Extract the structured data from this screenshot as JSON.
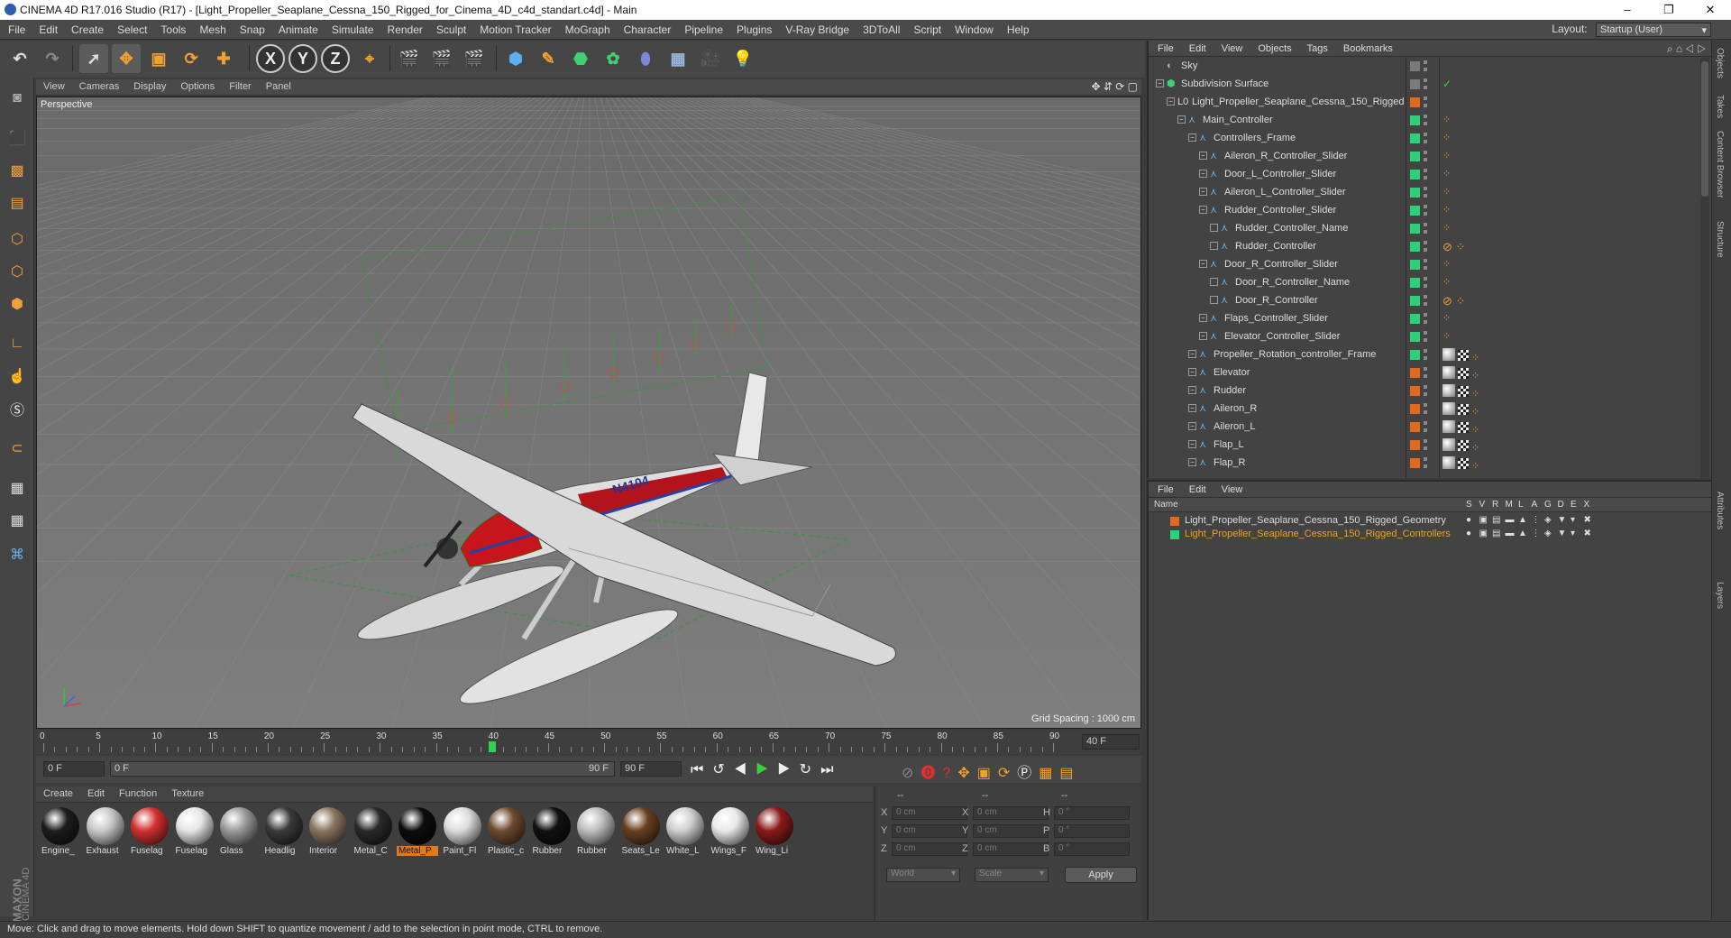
{
  "titlebar": {
    "title": "CINEMA 4D R17.016 Studio (R17) - [Light_Propeller_Seaplane_Cessna_150_Rigged_for_Cinema_4D_c4d_standart.c4d] - Main",
    "minimize": "–",
    "maximize": "❐",
    "close": "✕"
  },
  "menubar": {
    "items": [
      "File",
      "Edit",
      "Create",
      "Select",
      "Tools",
      "Mesh",
      "Snap",
      "Animate",
      "Simulate",
      "Render",
      "Sculpt",
      "Motion Tracker",
      "MoGraph",
      "Character",
      "Pipeline",
      "Plugins",
      "V-Ray Bridge",
      "3DToAll",
      "Script",
      "Window",
      "Help"
    ],
    "layout_label": "Layout:",
    "layout_value": "Startup (User)"
  },
  "toolbar": {
    "axis_x": "X",
    "axis_y": "Y",
    "axis_z": "Z"
  },
  "viewport": {
    "menu": [
      "View",
      "Cameras",
      "Display",
      "Options",
      "Filter",
      "Panel"
    ],
    "label": "Perspective",
    "grid_spacing": "Grid Spacing : 1000 cm",
    "tail_number": "N4104"
  },
  "timeline": {
    "ticks": [
      "0",
      "5",
      "10",
      "15",
      "20",
      "25",
      "30",
      "35",
      "40",
      "45",
      "50",
      "55",
      "60",
      "65",
      "70",
      "75",
      "80",
      "85",
      "90"
    ],
    "current_frame_field": "40 F",
    "playhead_frame": 40
  },
  "transport": {
    "start_field": "0 F",
    "range_start": "0 F",
    "range_end": "90 F",
    "end_field": "90 F"
  },
  "materials": {
    "menu": [
      "Create",
      "Edit",
      "Function",
      "Texture"
    ],
    "items": [
      {
        "label": "Engine_",
        "color": "#1d1d1d"
      },
      {
        "label": "Exhaust",
        "color": "#c8c8c8"
      },
      {
        "label": "Fuselag",
        "color": "#d23030"
      },
      {
        "label": "Fuselag",
        "color": "#e5e5e5"
      },
      {
        "label": "Glass",
        "color": "#9a9a9a"
      },
      {
        "label": "Headlig",
        "color": "#3a3a3a"
      },
      {
        "label": "Interior",
        "color": "#8a7460"
      },
      {
        "label": "Metal_C",
        "color": "#2a2a2a"
      },
      {
        "label": "Metal_P",
        "color": "#0d0d0d"
      },
      {
        "label": "Paint_Fl",
        "color": "#dcdcdc"
      },
      {
        "label": "Plastic_c",
        "color": "#6e4a30"
      },
      {
        "label": "Rubber",
        "color": "#111111"
      },
      {
        "label": "Rubber",
        "color": "#bdbdbd"
      },
      {
        "label": "Seats_Le",
        "color": "#6a4020"
      },
      {
        "label": "White_L",
        "color": "#cfcfcf"
      },
      {
        "label": "Wings_F",
        "color": "#e8e8e8"
      },
      {
        "label": "Wing_Li",
        "color": "#8a1a1a"
      }
    ],
    "selected_index": 8
  },
  "coords": {
    "headers": [
      "--",
      "--",
      "--"
    ],
    "rows": [
      {
        "a": "X",
        "av": "0 cm",
        "b": "X",
        "bv": "0 cm",
        "c": "H",
        "cv": "0 °"
      },
      {
        "a": "Y",
        "av": "0 cm",
        "b": "Y",
        "bv": "0 cm",
        "c": "P",
        "cv": "0 °"
      },
      {
        "a": "Z",
        "av": "0 cm",
        "b": "Z",
        "bv": "0 cm",
        "c": "B",
        "cv": "0 °"
      }
    ],
    "mode1": "World",
    "mode2": "Scale",
    "apply": "Apply"
  },
  "objects": {
    "menu": [
      "File",
      "Edit",
      "View",
      "Objects",
      "Tags",
      "Bookmarks"
    ],
    "rows": [
      {
        "name": "Sky",
        "depth": 0,
        "icon": "sky",
        "layer": "#7a7a7a",
        "tags": ""
      },
      {
        "name": "Subdivision Surface",
        "depth": 0,
        "icon": "subdiv",
        "layer": "#7a7a7a",
        "tags": "check"
      },
      {
        "name": "Light_Propeller_Seaplane_Cessna_150_Rigged",
        "depth": 1,
        "icon": "null",
        "layer": "#e06a20",
        "tags": ""
      },
      {
        "name": "Main_Controller",
        "depth": 2,
        "icon": "joint",
        "layer": "#2fd07a",
        "tags": "dot"
      },
      {
        "name": "Controllers_Frame",
        "depth": 3,
        "icon": "joint",
        "layer": "#2fd07a",
        "tags": "dot"
      },
      {
        "name": "Aileron_R_Controller_Slider",
        "depth": 4,
        "icon": "joint",
        "layer": "#2fd07a",
        "tags": "dot"
      },
      {
        "name": "Door_L_Controller_Slider",
        "depth": 4,
        "icon": "joint",
        "layer": "#2fd07a",
        "tags": "dot"
      },
      {
        "name": "Aileron_L_Controller_Slider",
        "depth": 4,
        "icon": "joint",
        "layer": "#2fd07a",
        "tags": "dot"
      },
      {
        "name": "Rudder_Controller_Slider",
        "depth": 4,
        "icon": "joint",
        "layer": "#2fd07a",
        "tags": "dot"
      },
      {
        "name": "Rudder_Controller_Name",
        "depth": 5,
        "icon": "joint",
        "layer": "#2fd07a",
        "tags": "dot"
      },
      {
        "name": "Rudder_Controller",
        "depth": 5,
        "icon": "joint",
        "layer": "#2fd07a",
        "tags": "no"
      },
      {
        "name": "Door_R_Controller_Slider",
        "depth": 4,
        "icon": "joint",
        "layer": "#2fd07a",
        "tags": "dot"
      },
      {
        "name": "Door_R_Controller_Name",
        "depth": 5,
        "icon": "joint",
        "layer": "#2fd07a",
        "tags": "dot"
      },
      {
        "name": "Door_R_Controller",
        "depth": 5,
        "icon": "joint",
        "layer": "#2fd07a",
        "tags": "no"
      },
      {
        "name": "Flaps_Controller_Slider",
        "depth": 4,
        "icon": "joint",
        "layer": "#2fd07a",
        "tags": "dot"
      },
      {
        "name": "Elevator_Controller_Slider",
        "depth": 4,
        "icon": "joint",
        "layer": "#2fd07a",
        "tags": "dot"
      },
      {
        "name": "Propeller_Rotation_controller_Frame",
        "depth": 3,
        "icon": "joint",
        "layer": "#2fd07a",
        "tags": "mat"
      },
      {
        "name": "Elevator",
        "depth": 3,
        "icon": "joint",
        "layer": "#e06a20",
        "tags": "mat"
      },
      {
        "name": "Rudder",
        "depth": 3,
        "icon": "joint",
        "layer": "#e06a20",
        "tags": "mat"
      },
      {
        "name": "Aileron_R",
        "depth": 3,
        "icon": "joint",
        "layer": "#e06a20",
        "tags": "mat"
      },
      {
        "name": "Aileron_L",
        "depth": 3,
        "icon": "joint",
        "layer": "#e06a20",
        "tags": "mat"
      },
      {
        "name": "Flap_L",
        "depth": 3,
        "icon": "joint",
        "layer": "#e06a20",
        "tags": "mat"
      },
      {
        "name": "Flap_R",
        "depth": 3,
        "icon": "joint",
        "layer": "#e06a20",
        "tags": "mat"
      }
    ]
  },
  "layers": {
    "menu": [
      "File",
      "Edit",
      "View"
    ],
    "header_name": "Name",
    "header_cols": [
      "S",
      "V",
      "R",
      "M",
      "L",
      "A",
      "G",
      "D",
      "E",
      "X"
    ],
    "rows": [
      {
        "name": "Light_Propeller_Seaplane_Cessna_150_Rigged_Geometry",
        "color": "#e06a20",
        "text_color": "#dddddd"
      },
      {
        "name": "Light_Propeller_Seaplane_Cessna_150_Rigged_Controllers",
        "color": "#2fd07a",
        "text_color": "#f0a020"
      }
    ]
  },
  "right_tabs": [
    "Objects",
    "Takes",
    "Content Browser",
    "Structure",
    "Attributes",
    "Layers"
  ],
  "status": "Move: Click and drag to move elements. Hold down SHIFT to quantize movement / add to the selection in point mode, CTRL to remove.",
  "brand": {
    "line1": "MAXON",
    "line2": "CINEMA 4D"
  }
}
